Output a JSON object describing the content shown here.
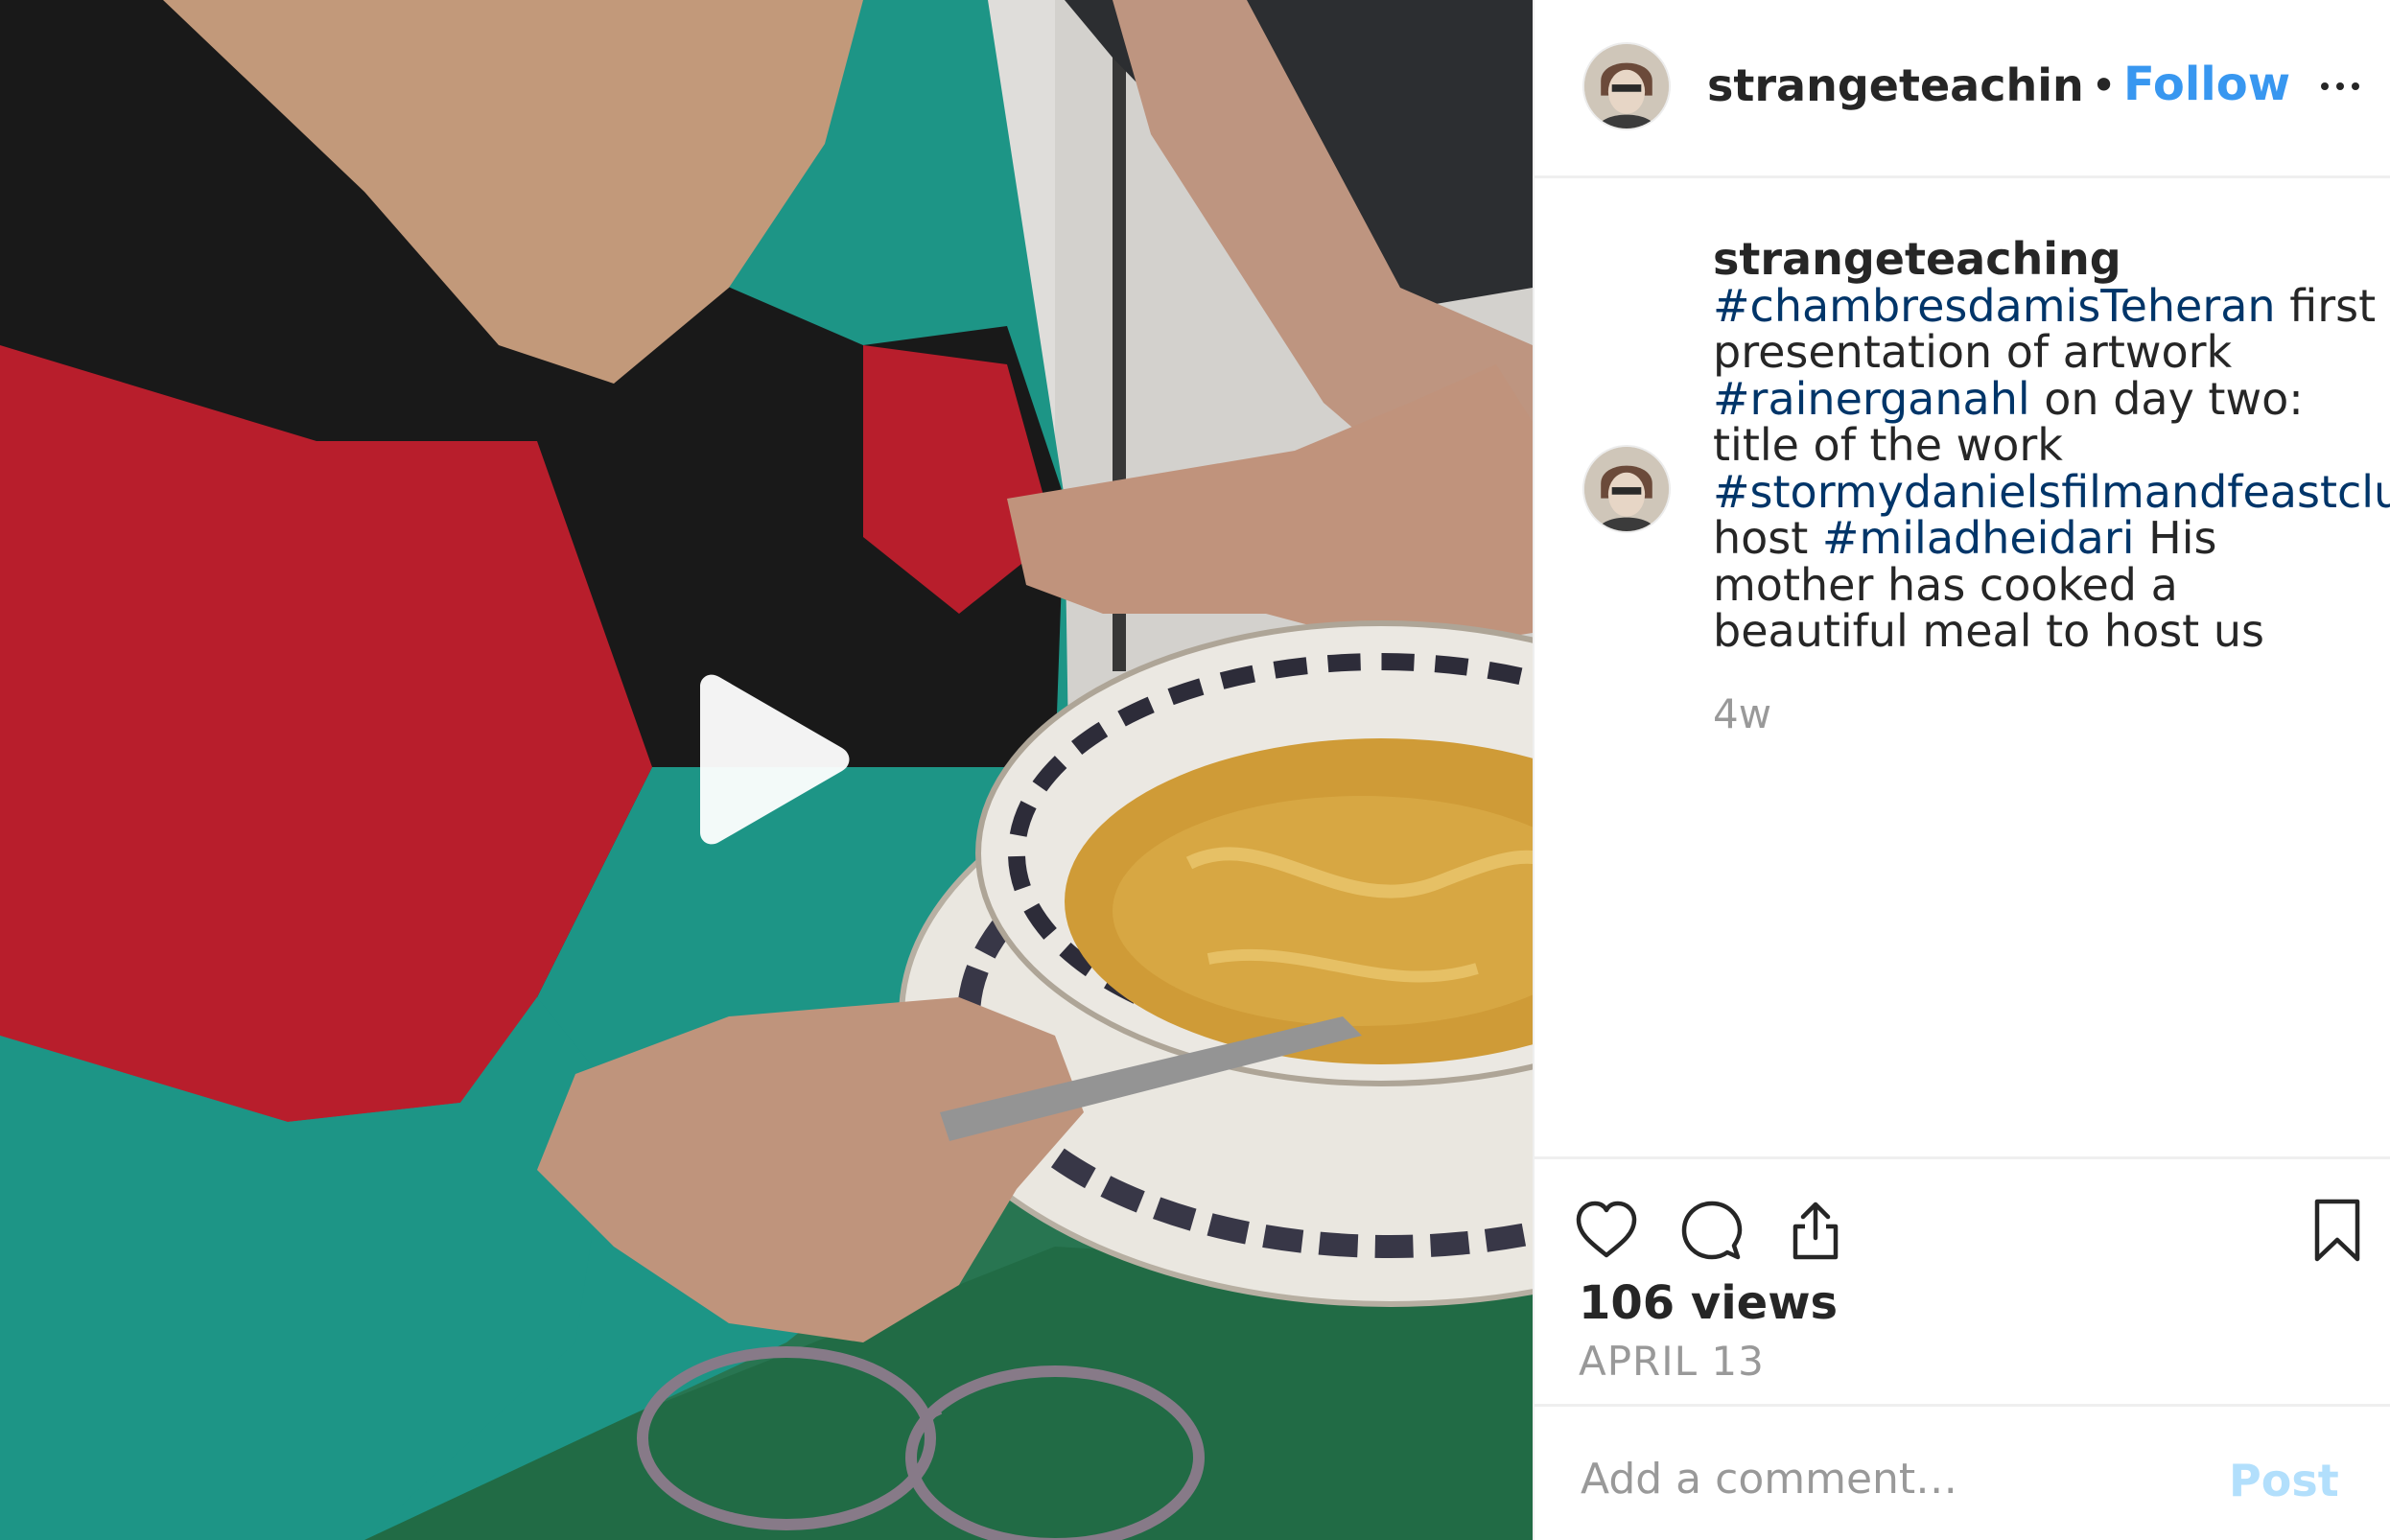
{
  "post": {
    "username": "strangeteaching",
    "follow_label": "Follow",
    "separator": "•",
    "caption": {
      "username": "strangeteaching",
      "segments": [
        {
          "type": "tag",
          "text": "#chambresdamisTeheran"
        },
        {
          "type": "text",
          "text": " first presentation of artwork "
        },
        {
          "type": "tag",
          "text": "#rainerganahl"
        },
        {
          "type": "text",
          "text": " on day two: title of the work "
        },
        {
          "type": "tag",
          "text": "#stormydanielsfilmandfeastclub"
        },
        {
          "type": "text",
          "text": " host "
        },
        {
          "type": "tag",
          "text": "#miladheidari"
        },
        {
          "type": "text",
          "text": " His mother has cooked a beautiful meal to host us"
        }
      ]
    },
    "timestamp": "4w",
    "views": "106 views",
    "date": "APRIL 13"
  },
  "comment": {
    "placeholder": "Add a comment…",
    "post_label": "Post"
  },
  "colors": {
    "link": "#3897f0",
    "hashtag": "#003569",
    "muted": "#999999",
    "post_disabled": "#b2dffc"
  },
  "icons": {
    "play": "play-icon",
    "more": "more-options-icon",
    "like": "heart-icon",
    "comment": "comment-icon",
    "share": "share-icon",
    "save": "bookmark-icon"
  }
}
